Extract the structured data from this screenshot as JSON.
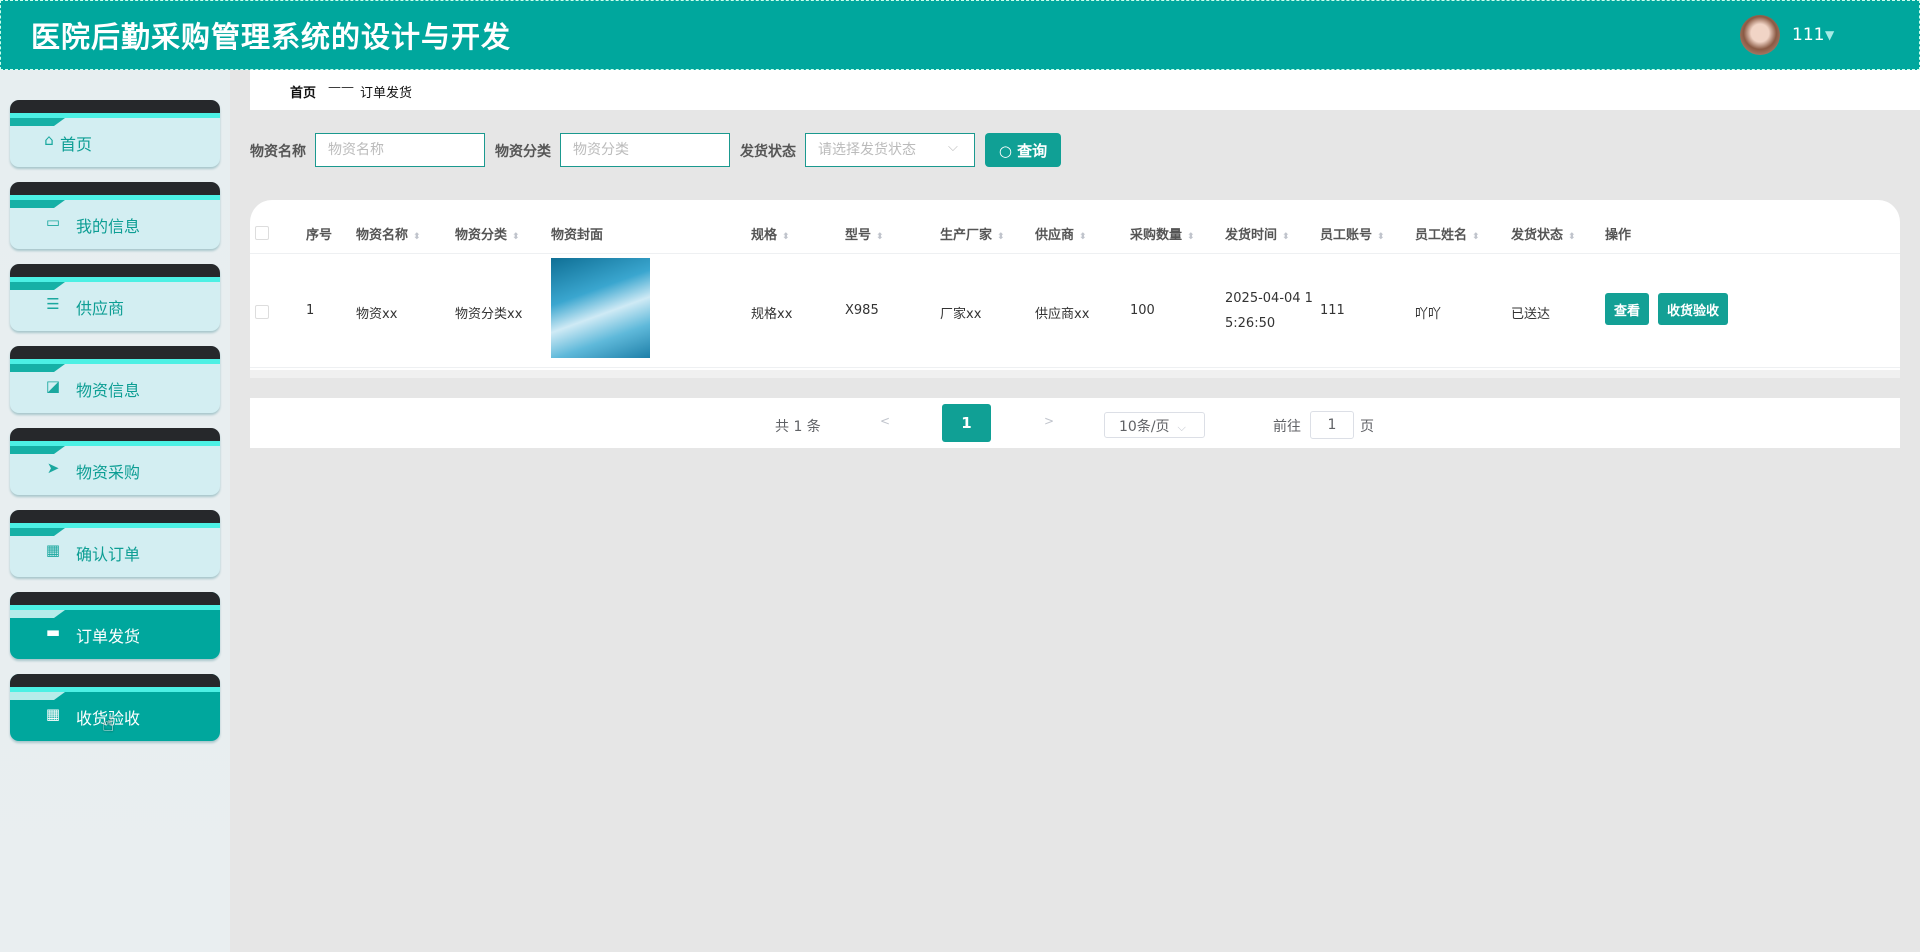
{
  "header": {
    "title": "医院后勤采购管理系统的设计与开发",
    "username": "111",
    "caret": "▼"
  },
  "sidebar": {
    "items": [
      {
        "label": "首页",
        "icon": "home-icon",
        "glyph": "⌂",
        "active": false
      },
      {
        "label": "我的信息",
        "icon": "card-icon",
        "glyph": "▭",
        "active": false
      },
      {
        "label": "供应商",
        "icon": "sliders-icon",
        "glyph": "☰",
        "active": false
      },
      {
        "label": "物资信息",
        "icon": "chart-icon",
        "glyph": "◪",
        "active": false
      },
      {
        "label": "物资采购",
        "icon": "send-icon",
        "glyph": "➤",
        "active": false
      },
      {
        "label": "确认订单",
        "icon": "grid-icon",
        "glyph": "▦",
        "active": false
      },
      {
        "label": "订单发货",
        "icon": "ticket-icon",
        "glyph": "▬",
        "active": true
      },
      {
        "label": "收货验收",
        "icon": "grid-icon",
        "glyph": "▦",
        "active": true
      }
    ]
  },
  "breadcrumb": {
    "home": "首页",
    "sep": "——",
    "current": "订单发货"
  },
  "search": {
    "name_label": "物资名称",
    "name_placeholder": "物资名称",
    "category_label": "物资分类",
    "category_placeholder": "物资分类",
    "status_label": "发货状态",
    "status_placeholder": "请选择发货状态",
    "button": "查询"
  },
  "table": {
    "columns": [
      "序号",
      "物资名称",
      "物资分类",
      "物资封面",
      "规格",
      "型号",
      "生产厂家",
      "供应商",
      "采购数量",
      "发货时间",
      "员工账号",
      "员工姓名",
      "发货状态",
      "操作"
    ],
    "rows": [
      {
        "index": "1",
        "name": "物资xx",
        "category": "物资分类xx",
        "spec": "规格xx",
        "model": "X985",
        "manufacturer": "厂家xx",
        "supplier": "供应商xx",
        "quantity": "100",
        "time_line1": "2025-04-04 1",
        "time_line2": "5:26:50",
        "account": "111",
        "staff": "吖吖",
        "status": "已送达",
        "actions": [
          "查看",
          "收货验收"
        ]
      }
    ]
  },
  "pagination": {
    "total": "共 1 条",
    "prev": "<",
    "page": "1",
    "next": ">",
    "page_size": "10条/页",
    "goto": "前往",
    "goto_value": "1",
    "page_unit": "页"
  },
  "colors": {
    "primary": "#00a79d",
    "dark_band": "#26282b",
    "stripe": "#4cf0e4"
  }
}
